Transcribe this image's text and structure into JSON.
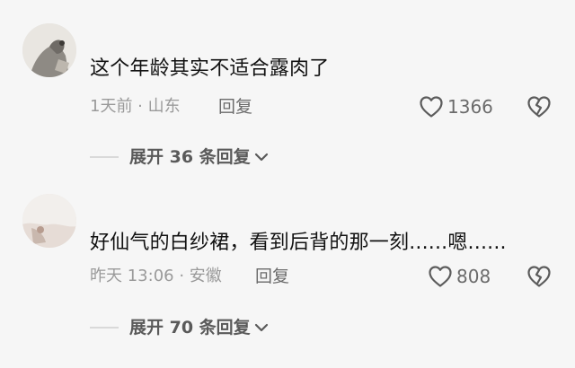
{
  "comments": [
    {
      "text": "这个年龄其实不适合露肉了",
      "meta": "1天前 · 山东",
      "reply_label": "回复",
      "like_count": "1366",
      "expand_label": "展开 36 条回复"
    },
    {
      "text": "好仙气的白纱裙，看到后背的那一刻......嗯......",
      "meta": "昨天 13:06 · 安徽",
      "reply_label": "回复",
      "like_count": "808",
      "expand_label": "展开 70 条回复"
    }
  ],
  "icons": {
    "like": "heart-outline-icon",
    "dislike": "broken-heart-icon",
    "expand": "chevron-down-icon"
  },
  "colors": {
    "background": "#f6f6f6",
    "text": "#111111",
    "meta": "#9a9a9a",
    "action": "#6b6b6b"
  }
}
